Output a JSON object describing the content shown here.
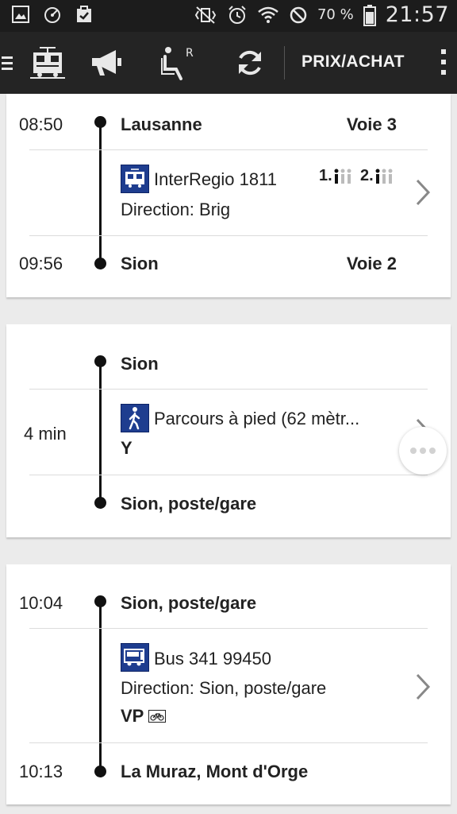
{
  "status_bar": {
    "battery_percent": "70 %",
    "clock": "21:57"
  },
  "app_bar": {
    "price_button": "PRIX/ACHAT",
    "seat_badge": "R"
  },
  "colors": {
    "app_bar": "#242424",
    "status_bar": "#1c1c1c",
    "transport_icon_bg": "#1e3d8f",
    "background": "#ebebeb"
  },
  "journey": {
    "leg1": {
      "departure_time": "08:50",
      "departure_station": "Lausanne",
      "departure_platform": "Voie 3",
      "line": "InterRegio 1811",
      "direction": "Direction: Brig",
      "occupancy_first": "1.",
      "occupancy_second": "2.",
      "arrival_time": "09:56",
      "arrival_station": "Sion",
      "arrival_platform": "Voie 2",
      "mode_icon": "train-icon"
    },
    "leg2": {
      "from_station": "Sion",
      "duration": "4 min",
      "line": "Parcours à pied (62 mètr...",
      "attribute": "Y",
      "to_station": "Sion, poste/gare",
      "mode_icon": "walk-icon"
    },
    "leg3": {
      "departure_time": "10:04",
      "departure_station": "Sion, poste/gare",
      "line": "Bus 341 99450",
      "direction": "Direction: Sion, poste/gare",
      "attribute": "VP",
      "arrival_time": "10:13",
      "arrival_station": "La Muraz, Mont d'Orge",
      "mode_icon": "bus-icon"
    }
  }
}
